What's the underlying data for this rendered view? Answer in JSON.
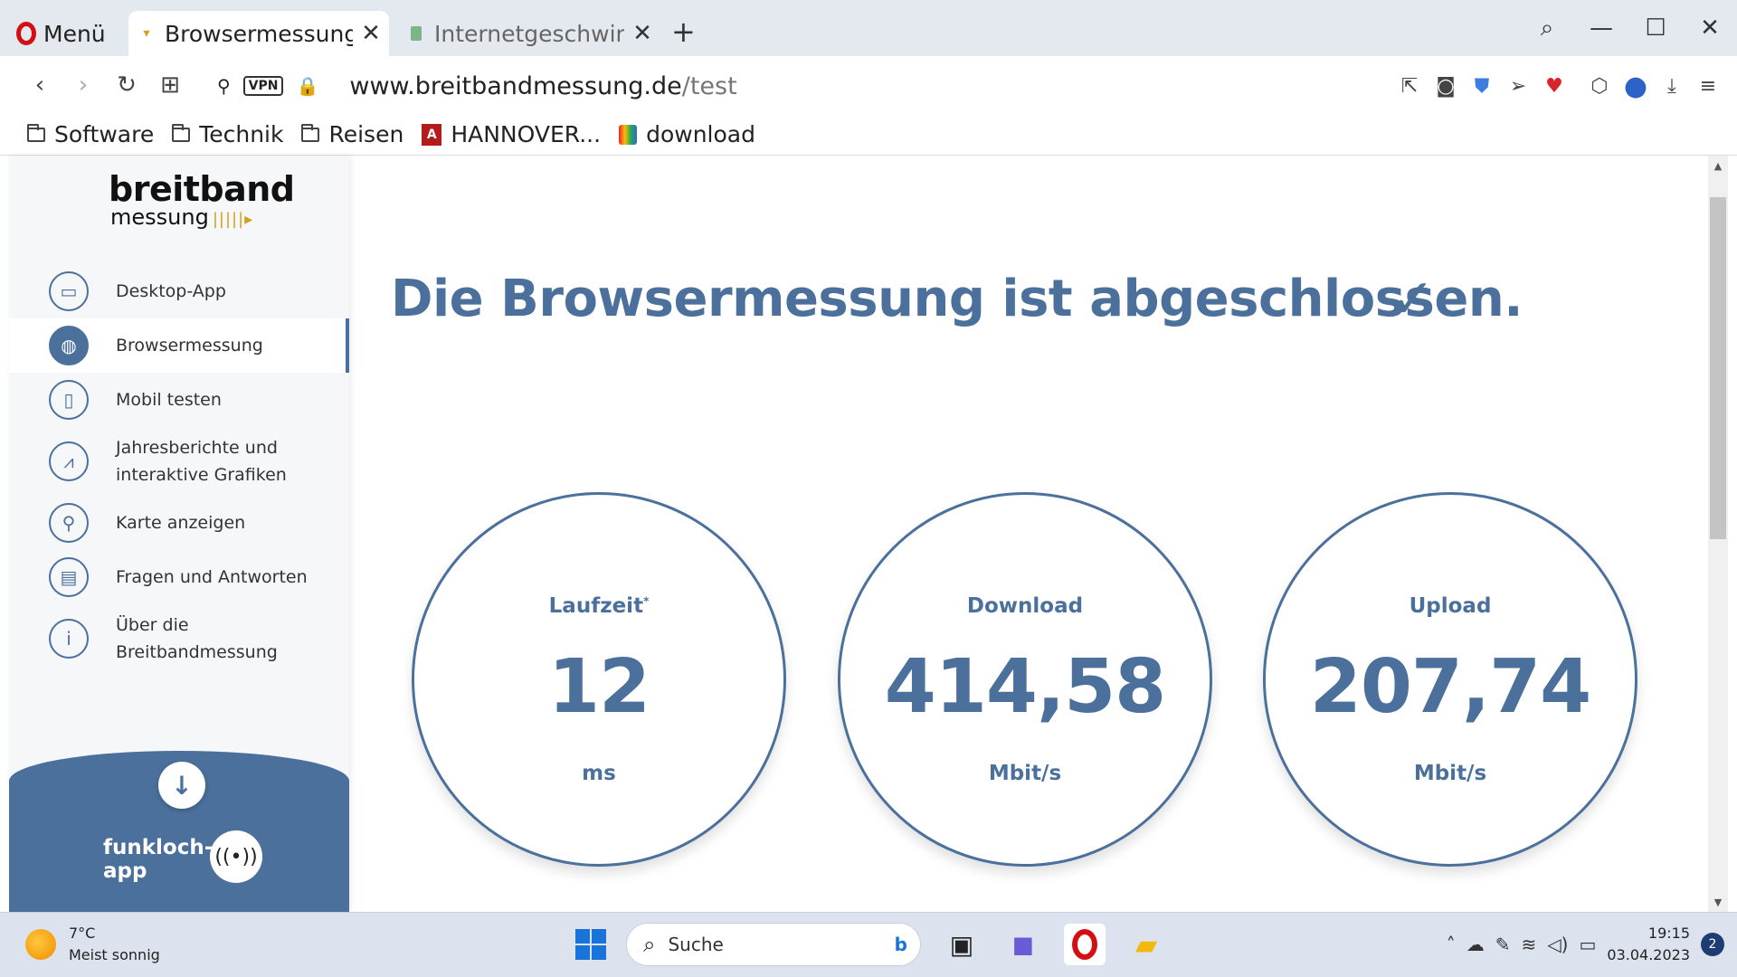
{
  "browser": {
    "menu_label": "Menü",
    "tabs": [
      {
        "title": "Browsermessung | Breitbandmessung",
        "active": true
      },
      {
        "title": "Internetgeschwindigkeit",
        "active": false
      }
    ],
    "new_tab_symbol": "+",
    "url": {
      "host": "www.breitbandmessung.de",
      "path": "/test"
    },
    "vpn_badge": "VPN",
    "bookmarks": [
      {
        "label": "Software",
        "icon": "folder-icon"
      },
      {
        "label": "Technik",
        "icon": "folder-icon"
      },
      {
        "label": "Reisen",
        "icon": "folder-icon"
      },
      {
        "label": "HANNOVER...",
        "icon": "pdf-icon"
      },
      {
        "label": "download",
        "icon": "bag-icon"
      }
    ]
  },
  "site": {
    "logo": {
      "line1": "breitband",
      "line2": "messung"
    },
    "nav": [
      {
        "label": "Desktop-App",
        "icon": "monitor-icon"
      },
      {
        "label": "Browsermessung",
        "icon": "globe-icon",
        "active": true
      },
      {
        "label": "Mobil testen",
        "icon": "phone-icon"
      },
      {
        "label": "Jahresberichte und interaktive Grafiken",
        "icon": "chart-icon"
      },
      {
        "label": "Karte anzeigen",
        "icon": "map-pin-icon"
      },
      {
        "label": "Fragen und Antworten",
        "icon": "chat-icon"
      },
      {
        "label": "Über die Breitbandmessung",
        "icon": "info-icon"
      }
    ],
    "funkloch": {
      "line1": "funkloch-",
      "line2": "app"
    },
    "headline": "Die Browsermessung ist abgeschlossen.",
    "results": {
      "latency": {
        "label": "Laufzeit",
        "value": "12",
        "unit": "ms",
        "footnote": "*"
      },
      "download": {
        "label": "Download",
        "value": "414,58",
        "unit": "Mbit/s"
      },
      "upload": {
        "label": "Upload",
        "value": "207,74",
        "unit": "Mbit/s"
      }
    },
    "accent_color": "#4b709c"
  },
  "taskbar": {
    "weather": {
      "temp": "7°C",
      "desc": "Meist sonnig"
    },
    "search_placeholder": "Suche",
    "clock": {
      "time": "19:15",
      "date": "03.04.2023"
    },
    "notification_count": "2"
  }
}
